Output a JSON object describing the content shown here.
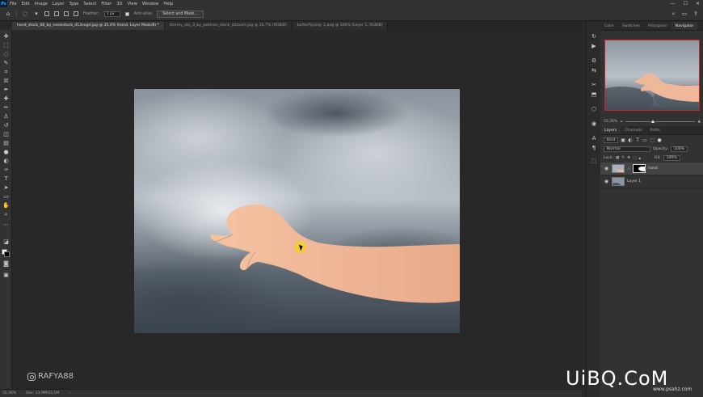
{
  "app": {
    "logo": "Ps"
  },
  "menu": [
    "File",
    "Edit",
    "Image",
    "Layer",
    "Type",
    "Select",
    "Filter",
    "3D",
    "View",
    "Window",
    "Help"
  ],
  "window_controls": {
    "minimize": "—",
    "maximize": "☐",
    "close": "✕"
  },
  "options": {
    "feather_label": "Feather:",
    "feather_value": "1 px",
    "antialias_label": "Anti-alias",
    "select_mask_button": "Select and Mask..."
  },
  "tabs": [
    {
      "label": "hand_stock_68_by_noxiestock_d13vxgd.jpg @ 35,4% (hand, Layer Mask/8) *",
      "active": true
    },
    {
      "label": "stormy_sky_3_by_pelleron_stock_d2zsark.jpg @ 16,7% (RGB/8)",
      "active": false
    },
    {
      "label": "butterfly.png: 1.png @ 100% (Layer 1, RGB/8)",
      "active": false
    }
  ],
  "status": {
    "zoom": "35,36%",
    "doc": "Doc: 13,9M/33,1M"
  },
  "panels": {
    "top_tabs": [
      {
        "label": "Color",
        "active": false
      },
      {
        "label": "Swatches",
        "active": false
      },
      {
        "label": "Histogram",
        "active": false
      },
      {
        "label": "Navigator",
        "active": true
      }
    ],
    "navigator_zoom": "35,36%",
    "layers_tabs": [
      {
        "label": "Layers",
        "active": true
      },
      {
        "label": "Channels",
        "active": false
      },
      {
        "label": "Paths",
        "active": false
      }
    ],
    "kind_label": "Kind",
    "blend_mode": "Normal",
    "opacity_label": "Opacity:",
    "opacity_value": "100%",
    "lock_label": "Lock:",
    "fill_label": "Fill:",
    "fill_value": "100%",
    "layers": [
      {
        "name": "hand",
        "active": true,
        "has_mask": true
      },
      {
        "name": "Layer 1",
        "active": false,
        "has_mask": false
      }
    ]
  },
  "watermarks": {
    "instagram": "RAFYA88",
    "site": "UiBQ.CoM",
    "site_sub": "www.psahz.com"
  },
  "colors": {
    "accent_cursor": "#f2cf2c",
    "navigator_frame": "#d02020"
  }
}
